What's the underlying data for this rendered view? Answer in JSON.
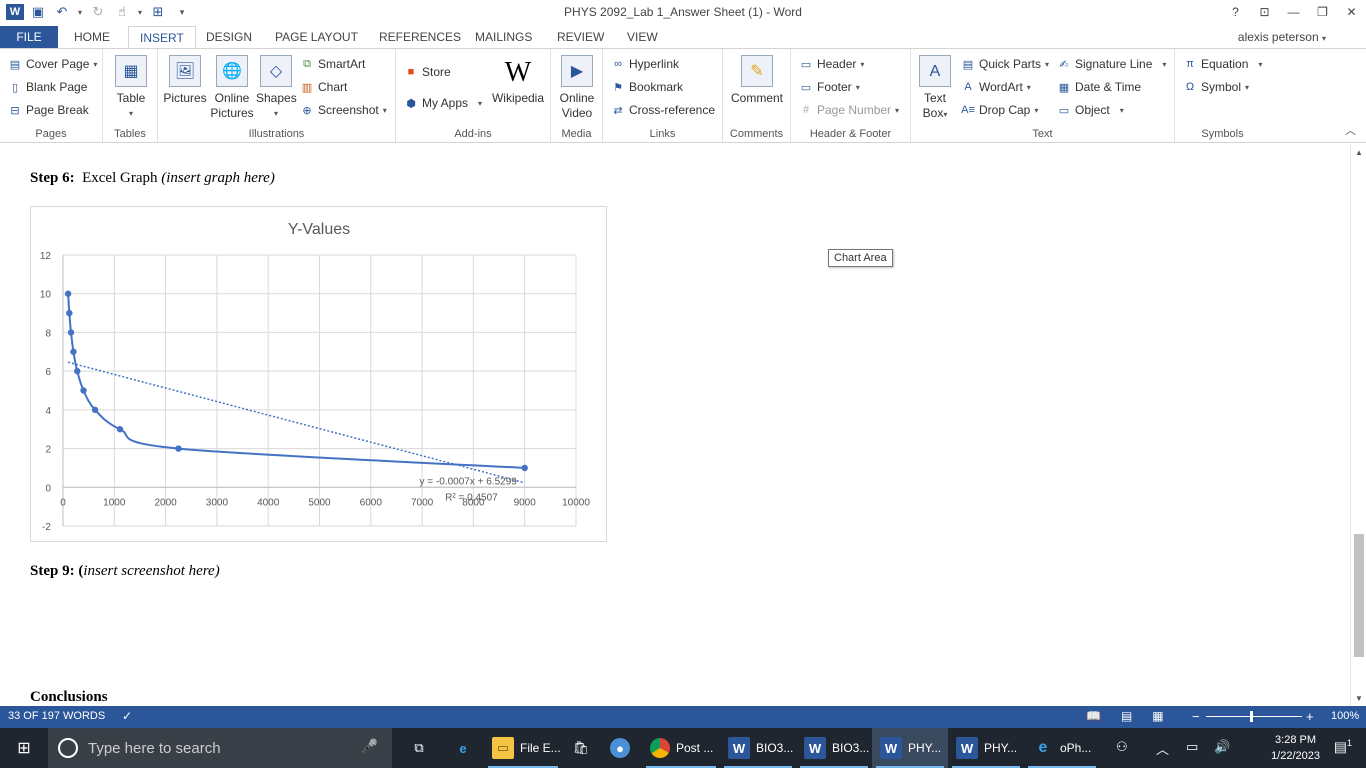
{
  "window": {
    "title": "PHYS 2092_Lab 1_Answer Sheet (1) - Word",
    "help": "?",
    "user": "alexis peterson"
  },
  "tabs": [
    "FILE",
    "HOME",
    "INSERT",
    "DESIGN",
    "PAGE LAYOUT",
    "REFERENCES",
    "MAILINGS",
    "REVIEW",
    "VIEW"
  ],
  "ribbon": {
    "pages": {
      "label": "Pages",
      "cover_page": "Cover Page",
      "blank_page": "Blank Page",
      "page_break": "Page Break"
    },
    "tables": {
      "label": "Tables",
      "table": "Table"
    },
    "illustrations": {
      "label": "Illustrations",
      "pictures": "Pictures",
      "online_pictures_1": "Online",
      "online_pictures_2": "Pictures",
      "shapes": "Shapes",
      "smartart": "SmartArt",
      "chart": "Chart",
      "screenshot": "Screenshot"
    },
    "addins": {
      "label": "Add-ins",
      "store": "Store",
      "my_apps": "My Apps",
      "wikipedia": "Wikipedia"
    },
    "media": {
      "label": "Media",
      "online_video_1": "Online",
      "online_video_2": "Video"
    },
    "links": {
      "label": "Links",
      "hyperlink": "Hyperlink",
      "bookmark": "Bookmark",
      "cross_reference": "Cross-reference"
    },
    "comments": {
      "label": "Comments",
      "comment": "Comment"
    },
    "header_footer": {
      "label": "Header & Footer",
      "header": "Header",
      "footer": "Footer",
      "page_number": "Page Number"
    },
    "text": {
      "label": "Text",
      "text_box_1": "Text",
      "text_box_2": "Box",
      "quick_parts": "Quick Parts",
      "wordart": "WordArt",
      "drop_cap": "Drop Cap",
      "signature_line": "Signature Line",
      "date_time": "Date & Time",
      "object": "Object"
    },
    "symbols": {
      "label": "Symbols",
      "equation": "Equation",
      "symbol": "Symbol"
    }
  },
  "document": {
    "step6_bold": "Step 6:",
    "step6_text": "Excel Graph",
    "step6_italic": "(insert graph here)",
    "step9_bold": "Step 9:",
    "step9_paren": "(",
    "step9_italic": "insert screenshot here)",
    "conclusions": "Conclusions",
    "tooltip": "Chart Area"
  },
  "chart_data": {
    "type": "scatter",
    "title": "Y-Values",
    "xlim": [
      0,
      10000
    ],
    "ylim": [
      -2,
      12
    ],
    "x_ticks": [
      0,
      1000,
      2000,
      3000,
      4000,
      5000,
      6000,
      7000,
      8000,
      9000,
      10000
    ],
    "y_ticks": [
      -2,
      0,
      2,
      4,
      6,
      8,
      10,
      12
    ],
    "grid": true,
    "legend": "none",
    "line_style": "smooth",
    "series": [
      {
        "x": [
          100,
          123,
          156,
          204,
          278,
          400,
          625,
          1111,
          2250,
          9000
        ],
        "y": [
          10,
          9,
          8,
          7,
          6,
          5,
          4,
          3,
          2,
          1
        ],
        "color": "#4472c4"
      }
    ],
    "trendline": {
      "type": "linear",
      "slope": -0.0007,
      "intercept": 6.5299,
      "x_range": [
        100,
        9000
      ],
      "style": "dotted",
      "color": "#4472c4"
    },
    "trendline_equation": "y = -0.0007x + 6.5299",
    "r_squared": "R² = 0.4507"
  },
  "status": {
    "words": "33 OF 197 WORDS",
    "zoom": "100%"
  },
  "taskbar": {
    "search_placeholder": "Type here to search",
    "items": [
      {
        "label": "File E...",
        "icon": "folder-icon"
      },
      {
        "label": "Post ...",
        "icon": "chrome-icon"
      },
      {
        "label": "BIO3...",
        "icon": "word-icon"
      },
      {
        "label": "BIO3...",
        "icon": "word-icon"
      },
      {
        "label": "PHY...",
        "icon": "word-icon"
      },
      {
        "label": "PHY...",
        "icon": "word-icon"
      },
      {
        "label": "oPh...",
        "icon": "edge-icon"
      }
    ],
    "time": "3:28 PM",
    "date": "1/22/2023",
    "notifications": "1"
  }
}
